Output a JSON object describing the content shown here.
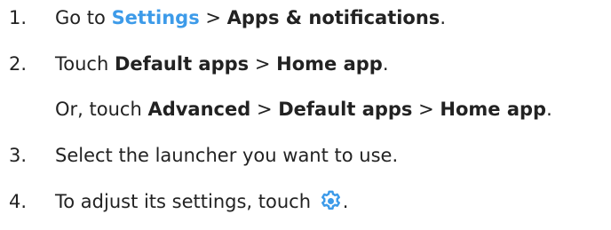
{
  "steps": [
    {
      "number": "1.",
      "go_to": "Go to ",
      "settings_link": "Settings",
      "separator": " > ",
      "apps_notifications": "Apps & notifications",
      "period": "."
    },
    {
      "number": "2.",
      "touch": "Touch ",
      "default_apps": "Default apps",
      "separator": " > ",
      "home_app": "Home app",
      "period": "."
    },
    {
      "alt_prefix": "Or, touch ",
      "advanced": "Advanced",
      "separator1": " > ",
      "default_apps": "Default apps",
      "separator2": " > ",
      "home_app": "Home app",
      "period": "."
    },
    {
      "number": "3.",
      "text": "Select the launcher you want to use."
    },
    {
      "number": "4.",
      "text": "To adjust its settings, touch ",
      "icon": "settings-gear-icon",
      "period": "."
    }
  ],
  "colors": {
    "text": "#222222",
    "link": "#3d9be9",
    "icon": "#3d9be9"
  }
}
